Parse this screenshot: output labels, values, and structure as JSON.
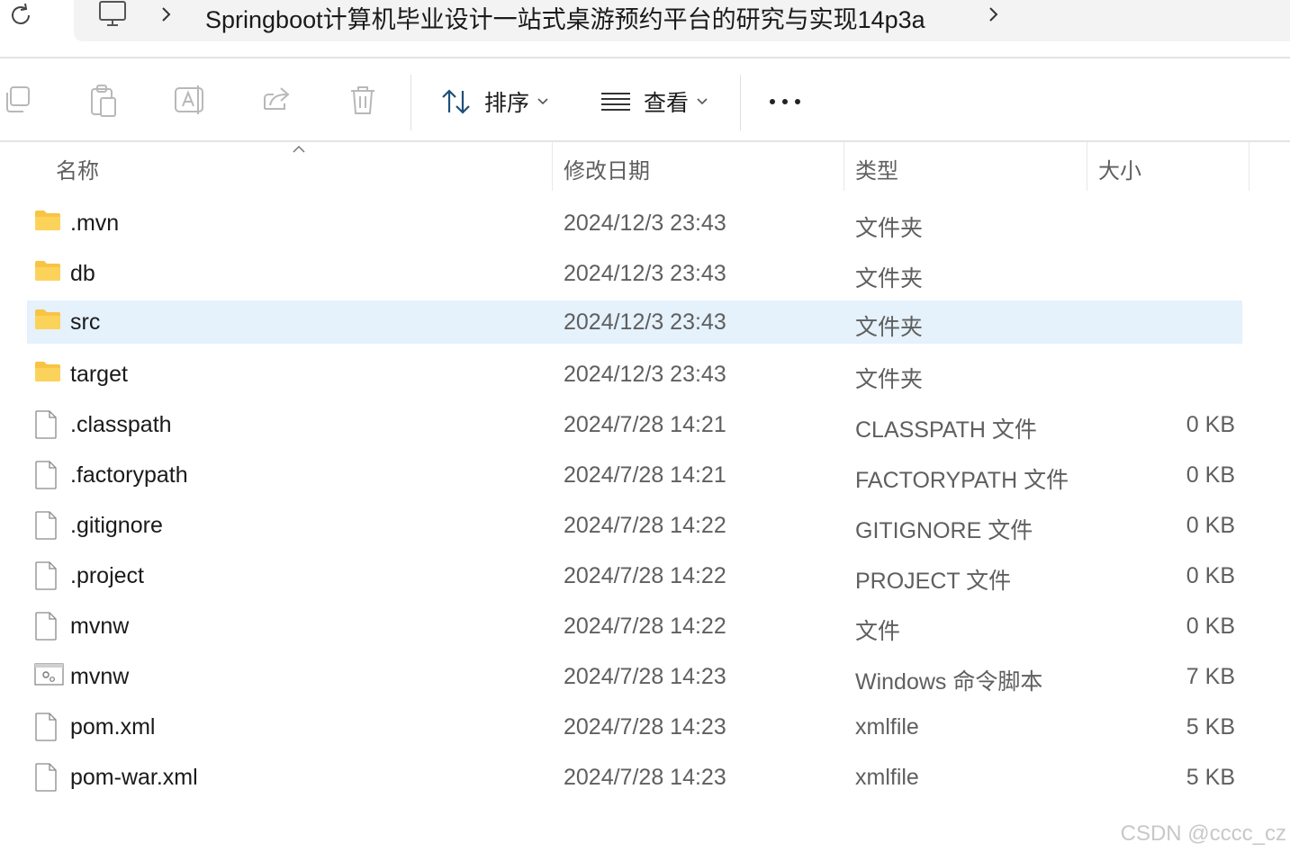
{
  "breadcrumb": {
    "path": "Springboot计算机毕业设计一站式桌游预约平台的研究与实现14p3a"
  },
  "toolbar": {
    "sort_label": "排序",
    "view_label": "查看"
  },
  "columns": {
    "name": "名称",
    "date": "修改日期",
    "type": "类型",
    "size": "大小"
  },
  "files": [
    {
      "name": ".mvn",
      "date": "2024/12/3 23:43",
      "type": "文件夹",
      "size": "",
      "icon": "folder-icon"
    },
    {
      "name": "db",
      "date": "2024/12/3 23:43",
      "type": "文件夹",
      "size": "",
      "icon": "folder-icon"
    },
    {
      "name": "src",
      "date": "2024/12/3 23:43",
      "type": "文件夹",
      "size": "",
      "icon": "folder-icon",
      "selected": true
    },
    {
      "name": "target",
      "date": "2024/12/3 23:43",
      "type": "文件夹",
      "size": "",
      "icon": "folder-icon"
    },
    {
      "name": ".classpath",
      "date": "2024/7/28 14:21",
      "type": "CLASSPATH 文件",
      "size": "0 KB",
      "icon": "file-icon"
    },
    {
      "name": ".factorypath",
      "date": "2024/7/28 14:21",
      "type": "FACTORYPATH 文件",
      "size": "0 KB",
      "icon": "file-icon"
    },
    {
      "name": ".gitignore",
      "date": "2024/7/28 14:22",
      "type": "GITIGNORE 文件",
      "size": "0 KB",
      "icon": "file-icon"
    },
    {
      "name": ".project",
      "date": "2024/7/28 14:22",
      "type": "PROJECT 文件",
      "size": "0 KB",
      "icon": "file-icon"
    },
    {
      "name": "mvnw",
      "date": "2024/7/28 14:22",
      "type": "文件",
      "size": "0 KB",
      "icon": "file-icon"
    },
    {
      "name": "mvnw",
      "date": "2024/7/28 14:23",
      "type": "Windows 命令脚本",
      "size": "7 KB",
      "icon": "script-icon"
    },
    {
      "name": "pom.xml",
      "date": "2024/7/28 14:23",
      "type": "xmlfile",
      "size": "5 KB",
      "icon": "file-icon"
    },
    {
      "name": "pom-war.xml",
      "date": "2024/7/28 14:23",
      "type": "xmlfile",
      "size": "5 KB",
      "icon": "file-icon"
    }
  ],
  "watermark": "CSDN @cccc_cz",
  "colors": {
    "selected_row": "#e5f1fb",
    "folder": "#f8c443",
    "secondary_text": "#5f5f5f"
  }
}
